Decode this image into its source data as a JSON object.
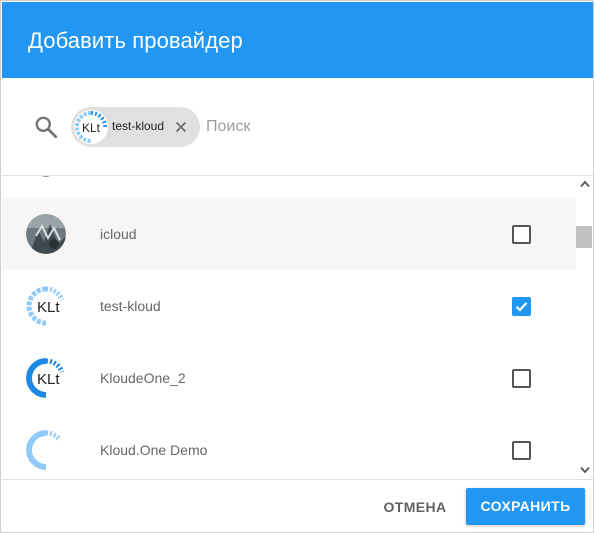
{
  "dialog": {
    "title": "Добавить провайдер"
  },
  "search": {
    "placeholder": "Поиск",
    "value": "",
    "chip": {
      "label": "test-kloud",
      "avatar_text": "KLt"
    }
  },
  "list": {
    "items": [
      {
        "label": "",
        "checked": false,
        "avatar": "partial-logo"
      },
      {
        "label": "icloud",
        "checked": false,
        "avatar": "photo"
      },
      {
        "label": "test-kloud",
        "checked": true,
        "avatar": "kloud-logo",
        "avatar_text": "KLt"
      },
      {
        "label": "KloudeOne_2",
        "checked": false,
        "avatar": "kloud-logo",
        "avatar_text": "KLt"
      },
      {
        "label": "Kloud.One Demo",
        "checked": false,
        "avatar": "kloud-logo-partial"
      }
    ]
  },
  "footer": {
    "cancel_label": "ОТМЕНА",
    "save_label": "СОХРАНИТЬ"
  },
  "colors": {
    "accent": "#2196F3",
    "logo_light": "#90CAF9"
  }
}
